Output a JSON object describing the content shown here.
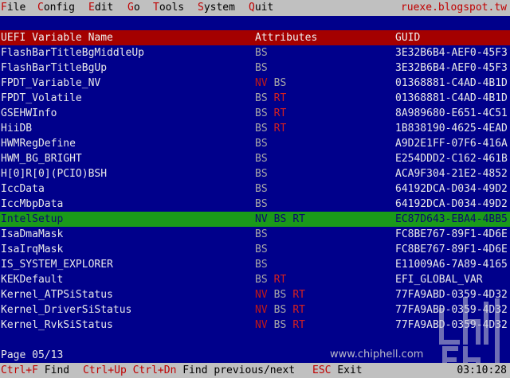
{
  "menu": {
    "items": [
      {
        "hot": "F",
        "rest": "ile"
      },
      {
        "hot": "C",
        "rest": "onfig"
      },
      {
        "hot": "E",
        "rest": "dit"
      },
      {
        "hot": "G",
        "rest": "o"
      },
      {
        "hot": "T",
        "rest": "ools"
      },
      {
        "hot": "S",
        "rest": "ystem"
      },
      {
        "hot": "Q",
        "rest": "uit"
      }
    ],
    "site": "ruexe.blogspot.tw"
  },
  "table": {
    "headers": {
      "name": "UEFI Variable Name",
      "attributes": "Attributes",
      "guid": "GUID"
    },
    "rows": [
      {
        "name": "FlashBarTitleBgMiddleUp",
        "attrs": [
          "BS"
        ],
        "guid": "3E32B6B4-AEF0-45F3"
      },
      {
        "name": "FlashBarTitleBgUp",
        "attrs": [
          "BS"
        ],
        "guid": "3E32B6B4-AEF0-45F3"
      },
      {
        "name": "FPDT_Variable_NV",
        "attrs": [
          "NV",
          "BS"
        ],
        "guid": "01368881-C4AD-4B1D"
      },
      {
        "name": "FPDT_Volatile",
        "attrs": [
          "BS",
          "RT"
        ],
        "guid": "01368881-C4AD-4B1D"
      },
      {
        "name": "GSEHWInfo",
        "attrs": [
          "BS",
          "RT"
        ],
        "guid": "8A989680-E651-4C51"
      },
      {
        "name": "HiiDB",
        "attrs": [
          "BS",
          "RT"
        ],
        "guid": "1B838190-4625-4EAD"
      },
      {
        "name": "HWMRegDefine",
        "attrs": [
          "BS"
        ],
        "guid": "A9D2E1FF-07F6-416A"
      },
      {
        "name": "HWM_BG_BRIGHT",
        "attrs": [
          "BS"
        ],
        "guid": "E254DDD2-C162-461B"
      },
      {
        "name": "H[0]R[0](PCIO)BSH",
        "attrs": [
          "BS"
        ],
        "guid": "ACA9F304-21E2-4852"
      },
      {
        "name": "IccData",
        "attrs": [
          "BS"
        ],
        "guid": "64192DCA-D034-49D2"
      },
      {
        "name": "IccMbpData",
        "attrs": [
          "BS"
        ],
        "guid": "64192DCA-D034-49D2"
      },
      {
        "name": "IntelSetup",
        "attrs": [
          "NV",
          "BS",
          "RT"
        ],
        "guid": "EC87D643-EBA4-4BB5",
        "selected": true
      },
      {
        "name": "IsaDmaMask",
        "attrs": [
          "BS"
        ],
        "guid": "FC8BE767-89F1-4D6E"
      },
      {
        "name": "IsaIrqMask",
        "attrs": [
          "BS"
        ],
        "guid": "FC8BE767-89F1-4D6E"
      },
      {
        "name": "IS_SYSTEM_EXPLORER",
        "attrs": [
          "BS"
        ],
        "guid": "E11009A6-7A89-4165"
      },
      {
        "name": "KEKDefault",
        "attrs": [
          "BS",
          "RT"
        ],
        "guid": "EFI_GLOBAL_VAR"
      },
      {
        "name": "Kernel_ATPSiStatus",
        "attrs": [
          "NV",
          "BS",
          "RT"
        ],
        "guid": "77FA9ABD-0359-4D32"
      },
      {
        "name": "Kernel_DriverSiStatus",
        "attrs": [
          "NV",
          "BS",
          "RT"
        ],
        "guid": "77FA9ABD-0359-4D32"
      },
      {
        "name": "Kernel_RvkSiStatus",
        "attrs": [
          "NV",
          "BS",
          "RT"
        ],
        "guid": "77FA9ABD-0359-4D32"
      }
    ]
  },
  "status": {
    "page": "Page 05/13",
    "watermark": "www.chiphell.com"
  },
  "footer": {
    "keys": [
      {
        "key": "Ctrl+F",
        "label": "Find"
      },
      {
        "key": "Ctrl+Up Ctrl+Dn",
        "label": "Find previous/next"
      },
      {
        "key": "ESC",
        "label": "Exit"
      }
    ],
    "clock": "03:10:28"
  },
  "colors": {
    "background": "#00008b",
    "header_bar": "#a40000",
    "selected_row": "#1a9a1a",
    "menu_bar": "#c0c0c0",
    "hotkey": "#c00000"
  }
}
